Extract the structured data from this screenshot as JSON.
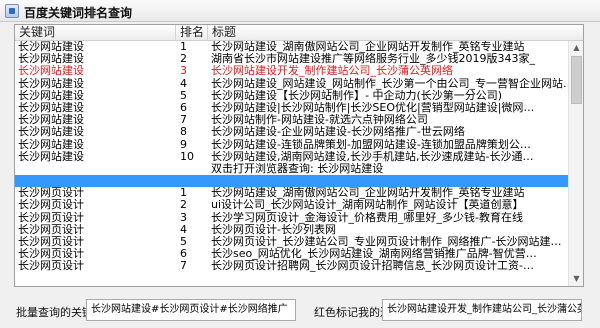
{
  "window": {
    "title": "百度关键词排名查询"
  },
  "table": {
    "columns": [
      "关键词",
      "排名",
      "标题"
    ],
    "rows": [
      {
        "keyword": "长沙网站建设",
        "rank": "1",
        "title": "长沙网站建设_湖南傲网站公司_企业网站开发制作_英铭专业建站",
        "highlight": ""
      },
      {
        "keyword": "长沙网站建设",
        "rank": "2",
        "title": "湖南省长沙市网站建设推广等网络服务行业_多少钱2019版343家_",
        "highlight": ""
      },
      {
        "keyword": "长沙网站建设",
        "rank": "3",
        "title": "长沙网站建设开发_制作建站公司_长沙蒲公英网络",
        "highlight": "red"
      },
      {
        "keyword": "长沙网站建设",
        "rank": "4",
        "title": "长沙网站建设_网站建设_网站制作_长沙第一个由公司_专一营智企业网站…",
        "highlight": ""
      },
      {
        "keyword": "长沙网站建设",
        "rank": "5",
        "title": "长沙网站建设【长沙网站制作】- 中企动力(长沙第一分公司)",
        "highlight": ""
      },
      {
        "keyword": "长沙网站建设",
        "rank": "6",
        "title": "长沙网站建设|长沙网站制作|长沙SEO优化|营销型网站建设|微网…",
        "highlight": ""
      },
      {
        "keyword": "长沙网站建设",
        "rank": "7",
        "title": "长沙网站制作-网站建设-就选六点钟网络公司",
        "highlight": ""
      },
      {
        "keyword": "长沙网站建设",
        "rank": "8",
        "title": "长沙网站建设-企业网站建设-长沙网络推广-世云网络",
        "highlight": ""
      },
      {
        "keyword": "长沙网站建设",
        "rank": "9",
        "title": "长沙网站建设-连锁品牌策划-加盟网站建设-连锁加盟品牌策划公…",
        "highlight": ""
      },
      {
        "keyword": "长沙网站建设",
        "rank": "10",
        "title": "长沙网站建设,湖南网站建设,长沙手机建站,长沙速成建站-长沙通…",
        "highlight": ""
      },
      {
        "keyword": "",
        "rank": "",
        "title": "双击打开浏览器查询: 长沙网站建设",
        "highlight": ""
      },
      {
        "keyword": "",
        "rank": "",
        "title": "",
        "highlight": "selected"
      },
      {
        "keyword": "长沙网页设计",
        "rank": "1",
        "title": "长沙网站建设_湖南傲网站公司_企业网站开发制作_英铭专业建站",
        "highlight": ""
      },
      {
        "keyword": "长沙网页设计",
        "rank": "2",
        "title": "ui设计公司_长沙网站设计_湖南网站制作_网站设计【英道创意】",
        "highlight": ""
      },
      {
        "keyword": "长沙网页设计",
        "rank": "3",
        "title": "长沙学习网页设计_金海设计_价格费用_哪里好_多少钱-教育在线",
        "highlight": ""
      },
      {
        "keyword": "长沙网页设计",
        "rank": "4",
        "title": "长沙网页设计-长沙列表网",
        "highlight": ""
      },
      {
        "keyword": "长沙网页设计",
        "rank": "5",
        "title": "长沙网页设计_长沙建站公司_专业网页设计制作_网络推广-长沙网站建…",
        "highlight": ""
      },
      {
        "keyword": "长沙网页设计",
        "rank": "6",
        "title": "长沙seo_网站优化_长沙网站建设_湖南网络营销推广品牌-智优营…",
        "highlight": ""
      },
      {
        "keyword": "长沙网页设计",
        "rank": "7",
        "title": "长沙网页设计招聘网_长沙网页设计招聘信息_长沙网页设计工资-…",
        "highlight": ""
      }
    ]
  },
  "bottom": {
    "batch_label": "批量查询的关键词",
    "batch_value": "长沙网站建设#长沙网页设计#长沙网络推广",
    "red_label": "红色标记我的连接",
    "red_value": "长沙网站建设开发_制作建站公司_长沙蒲公英网络"
  },
  "colors": {
    "selection": "#3399ff",
    "mark_red": "#e8191c"
  }
}
